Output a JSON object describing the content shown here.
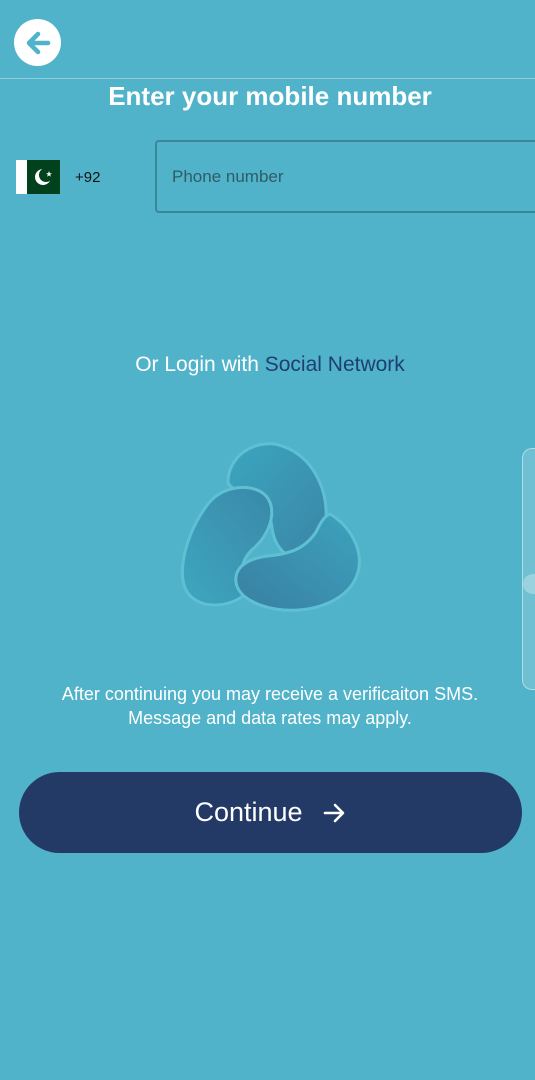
{
  "header": {
    "title": "Enter your mobile number"
  },
  "phone": {
    "country_flag": "pakistan-flag-icon",
    "dial_code": "+92",
    "placeholder": "Phone number",
    "value": ""
  },
  "social": {
    "prefix": "Or Login with ",
    "link_label": "Social Network"
  },
  "notice": {
    "line1": "After continuing you may receive a verificaiton SMS.",
    "line2": "Message and data rates may apply."
  },
  "continue": {
    "label": "Continue"
  },
  "colors": {
    "background": "#50b3c9",
    "button": "#243a66",
    "link": "#1f3f73",
    "flag_green": "#01411c"
  }
}
